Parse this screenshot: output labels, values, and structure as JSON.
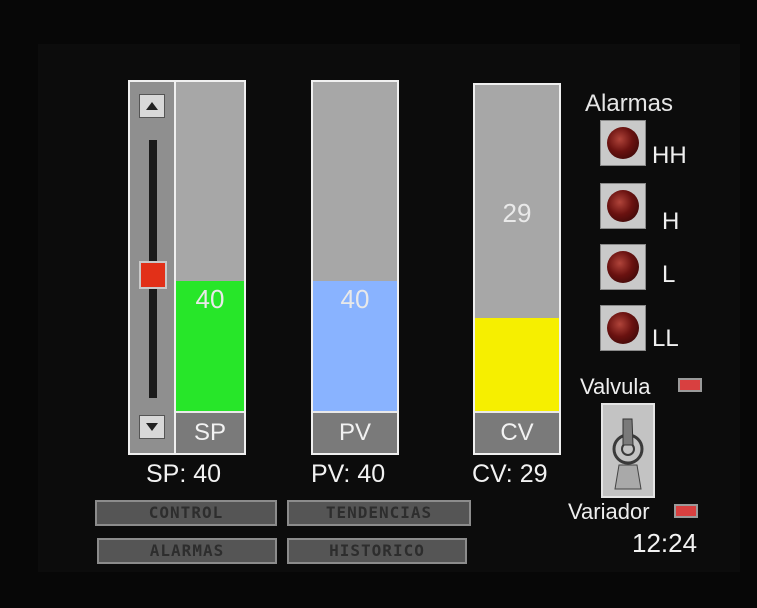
{
  "bars": {
    "sp": {
      "value": "40",
      "tag": "SP",
      "readout": "SP:  40",
      "level": 0.4,
      "color": "#27e629"
    },
    "pv": {
      "value": "40",
      "tag": "PV",
      "readout": "PV: 40",
      "level": 0.4,
      "color": "#89b3ff"
    },
    "cv": {
      "value": "29",
      "tag": "CV",
      "readout": "CV: 29",
      "level": 0.29,
      "color": "#f6ef00"
    }
  },
  "slider": {
    "level": 0.4
  },
  "alarms": {
    "title": "Alarmas",
    "items": [
      {
        "label": "HH",
        "icon": "alarm-lamp-icon"
      },
      {
        "label": "H",
        "icon": "alarm-lamp-icon"
      },
      {
        "label": "L",
        "icon": "alarm-lamp-icon"
      },
      {
        "label": "LL",
        "icon": "alarm-lamp-icon"
      }
    ]
  },
  "valve": {
    "label": "Valvula",
    "icon": "status-led-icon",
    "color": "#d84040"
  },
  "drive": {
    "label": "Variador",
    "icon": "status-led-icon",
    "color": "#d84040"
  },
  "toggle": {
    "icon": "toggle-switch-icon"
  },
  "nav": {
    "control": "CONTROL",
    "tendencias": "TENDENCIAS",
    "alarmas": "ALARMAS",
    "historico": "HISTORICO"
  },
  "clock": "12:24"
}
